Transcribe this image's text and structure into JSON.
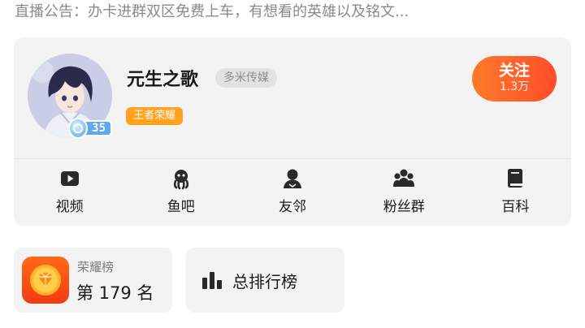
{
  "announcement": "直播公告：办卡进群双区免费上车，有想看的英雄以及铭文...",
  "profile": {
    "username": "元生之歌",
    "org_tag": "多米传媒",
    "game_tag": "王者荣耀",
    "level": "35",
    "avatar_icon": "anime-boy-avatar"
  },
  "follow": {
    "label": "关注",
    "count": "1.3万"
  },
  "tabs": [
    {
      "label": "视频",
      "icon": "video-play-icon"
    },
    {
      "label": "鱼吧",
      "icon": "octopus-icon"
    },
    {
      "label": "友邻",
      "icon": "person-icon"
    },
    {
      "label": "粉丝群",
      "icon": "group-icon"
    },
    {
      "label": "百科",
      "icon": "book-icon"
    }
  ],
  "ranking": {
    "title": "荣耀榜",
    "value": "第 179 名",
    "icon": "diamond-trophy-icon"
  },
  "leaderboard": {
    "label": "总排行榜",
    "icon": "bar-chart-icon"
  },
  "colors": {
    "accent_orange": "#ff5a2a",
    "game_tag": "#ffa21f",
    "card_bg": "#f3f3f3",
    "muted_text": "#8a8a8a",
    "level_blue": "#5fa8ea"
  }
}
